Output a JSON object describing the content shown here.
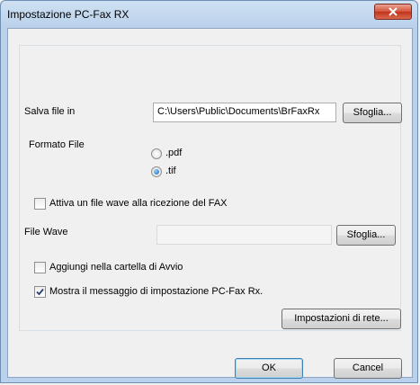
{
  "window": {
    "title": "Impostazione PC-Fax RX"
  },
  "save_to": {
    "label": "Salva file in",
    "value": "C:\\Users\\Public\\Documents\\BrFaxRx",
    "browse_label": "Sfoglia..."
  },
  "file_format": {
    "label": "Formato File",
    "options": [
      {
        "label": ".pdf",
        "selected": false
      },
      {
        "label": ".tif",
        "selected": true
      }
    ]
  },
  "wave": {
    "enable_label": "Attiva un file wave alla ricezione del FAX",
    "enabled": false,
    "file_label": "File Wave",
    "file_value": "",
    "browse_label": "Sfoglia..."
  },
  "startup": {
    "label": "Aggiungi nella cartella di Avvio",
    "checked": false
  },
  "show_message": {
    "label": "Mostra il messaggio di impostazione PC-Fax Rx.",
    "checked": true
  },
  "network_settings_label": "Impostazioni di rete...",
  "footer": {
    "ok_label": "OK",
    "cancel_label": "Cancel"
  }
}
